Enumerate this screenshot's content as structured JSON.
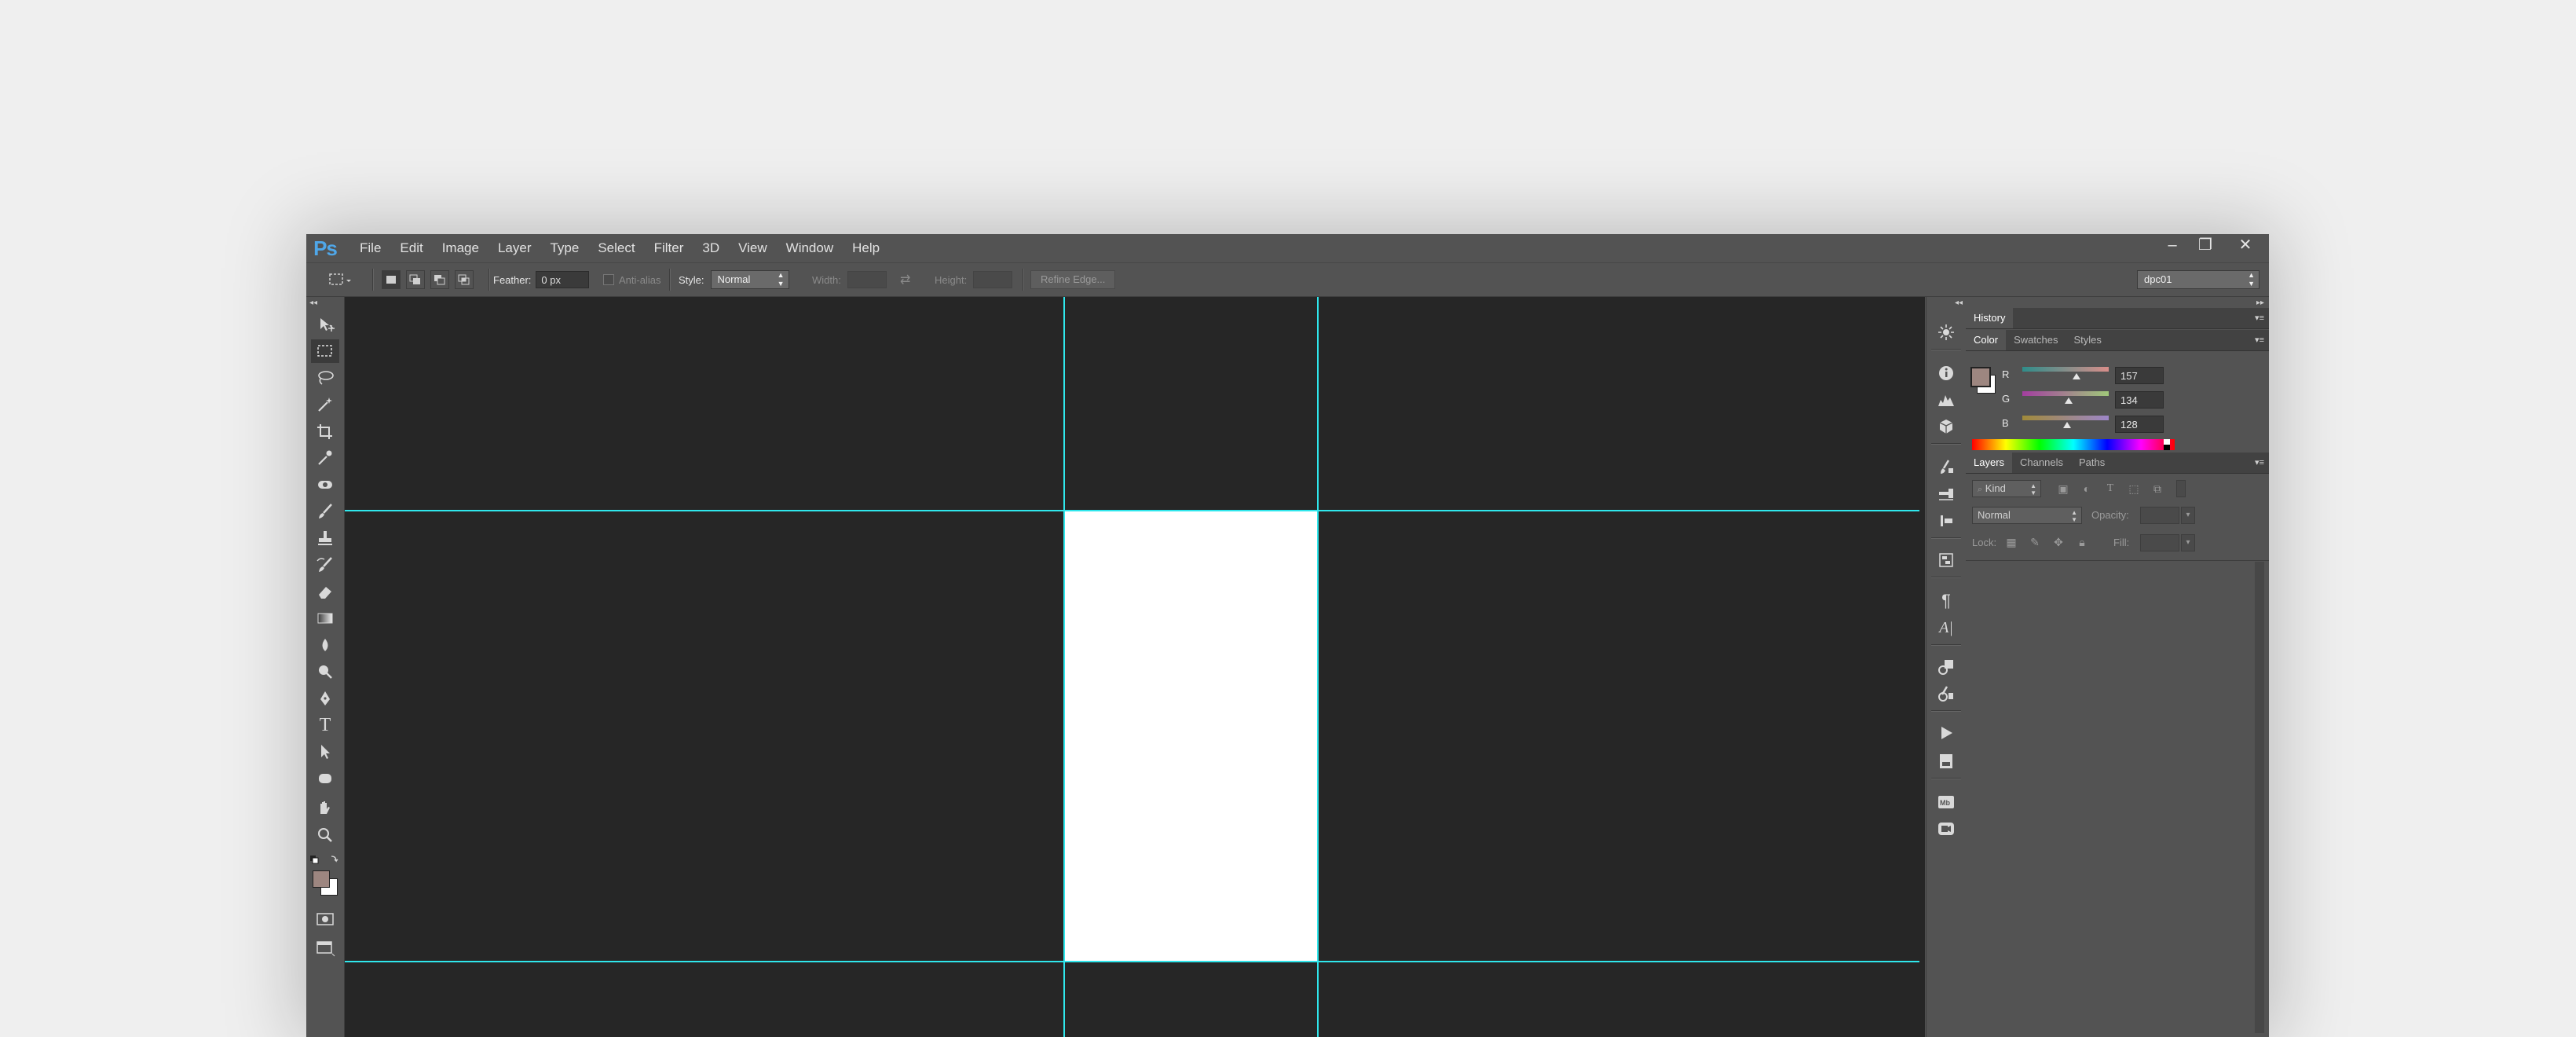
{
  "app": {
    "logo": "Ps"
  },
  "menu": [
    "File",
    "Edit",
    "Image",
    "Layer",
    "Type",
    "Select",
    "Filter",
    "3D",
    "View",
    "Window",
    "Help"
  ],
  "window_controls": {
    "minimize": "–",
    "restore": "❐",
    "close": "✕"
  },
  "options": {
    "feather_label": "Feather:",
    "feather_value": "0 px",
    "antialias_label": "Anti-alias",
    "style_label": "Style:",
    "style_value": "Normal",
    "width_label": "Width:",
    "height_label": "Height:",
    "refine_edge": "Refine Edge...",
    "workspace": "dpc01"
  },
  "history_panel": {
    "tab": "History"
  },
  "color_panel": {
    "tabs": [
      "Color",
      "Swatches",
      "Styles"
    ],
    "channels": [
      {
        "label": "R",
        "value": "157"
      },
      {
        "label": "G",
        "value": "134"
      },
      {
        "label": "B",
        "value": "128"
      }
    ],
    "foreground": "#9d8680",
    "background": "#ffffff"
  },
  "layers_panel": {
    "tabs": [
      "Layers",
      "Channels",
      "Paths"
    ],
    "filter_kind": "Kind",
    "blend_mode": "Normal",
    "opacity_label": "Opacity:",
    "lock_label": "Lock:",
    "fill_label": "Fill:"
  },
  "colors": {
    "guide": "#2fe7ec",
    "canvas": "#262626",
    "document": "#ffffff",
    "ui": "#535353",
    "logo": "#4fa7e9"
  }
}
